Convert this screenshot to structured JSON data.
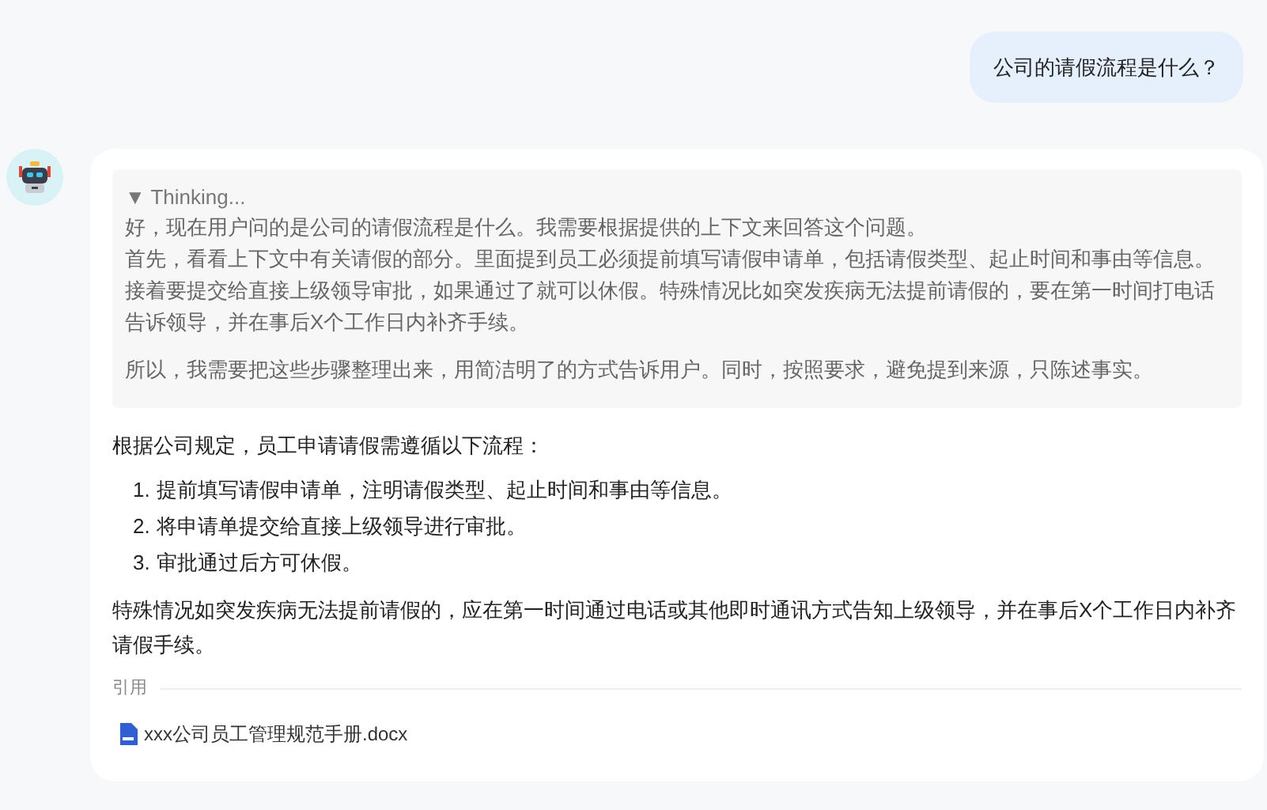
{
  "user_message": "公司的请假流程是什么？",
  "thinking": {
    "label": "▼ Thinking...",
    "paragraphs": [
      [
        "好，现在用户问的是公司的请假流程是什么。我需要根据提供的上下文来回答这个问题。",
        "首先，看看上下文中有关请假的部分。里面提到员工必须提前填写请假申请单，包括请假类型、起止时间和事由等信息。",
        "接着要提交给直接上级领导审批，如果通过了就可以休假。特殊情况比如突发疾病无法提前请假的，要在第一时间打电话告诉领导，并在事后X个工作日内补齐手续。"
      ],
      [
        "所以，我需要把这些步骤整理出来，用简洁明了的方式告诉用户。同时，按照要求，避免提到来源，只陈述事实。"
      ]
    ]
  },
  "answer": {
    "intro": "根据公司规定，员工申请请假需遵循以下流程：",
    "steps": [
      {
        "number": "1.",
        "text": "提前填写请假申请单，注明请假类型、起止时间和事由等信息。"
      },
      {
        "number": "2.",
        "text": "将申请单提交给直接上级领导进行审批。"
      },
      {
        "number": "3.",
        "text": "审批通过后方可休假。"
      }
    ],
    "note": "特殊情况如突发疾病无法提前请假的，应在第一时间通过电话或其他即时通讯方式告知上级领导，并在事后X个工作日内补齐请假手续。"
  },
  "references": {
    "label": "引用",
    "files": [
      {
        "name": "xxx公司员工管理规范手册.docx"
      }
    ]
  }
}
